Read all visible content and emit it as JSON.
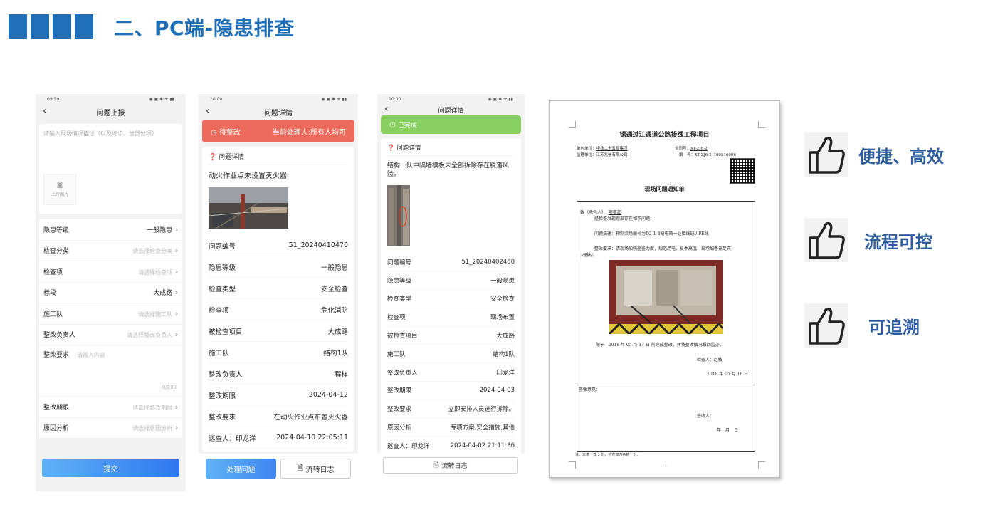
{
  "header": {
    "title": "二、PC端-隐患排查"
  },
  "phone1": {
    "status_time": "09:59",
    "nav_title": "问题上报",
    "desc_placeholder": "请输入现场情况描述（以及地点、分部分项）",
    "upload_label": "上传图片",
    "fields": [
      {
        "label": "隐患等级",
        "value": "一般隐患",
        "placeholder": false
      },
      {
        "label": "检查分类",
        "value": "请选择检查分类",
        "placeholder": true
      },
      {
        "label": "检查项",
        "value": "请选择检查项",
        "placeholder": true
      },
      {
        "label": "标段",
        "value": "大成路",
        "placeholder": false
      },
      {
        "label": "施工队",
        "value": "请选择施工队",
        "placeholder": true
      },
      {
        "label": "整改负责人",
        "value": "请选择整改负责人",
        "placeholder": true
      }
    ],
    "requirement_label": "整改要求",
    "requirement_placeholder": "请输入内容",
    "char_count": "0/200",
    "fields2": [
      {
        "label": "整改期限",
        "value": "请选择整改期限",
        "placeholder": true
      },
      {
        "label": "原因分析",
        "value": "请选择原因分析",
        "placeholder": true
      }
    ],
    "submit_label": "提交"
  },
  "phone2": {
    "status_time": "10:00",
    "nav_title": "问题详情",
    "status_label": "待整改",
    "handler_label": "当前处理人:所有人均可",
    "section_title": "问题详情",
    "description": "动火作业点未设置灭火器",
    "rows": [
      {
        "label": "问题编号",
        "value": "51_20240410470"
      },
      {
        "label": "隐患等级",
        "value": "一般隐患"
      },
      {
        "label": "检查类型",
        "value": "安全检查"
      },
      {
        "label": "检查项",
        "value": "危化消防"
      },
      {
        "label": "被检查项目",
        "value": "大成路"
      },
      {
        "label": "施工队",
        "value": "结构1队"
      },
      {
        "label": "整改负责人",
        "value": "程样"
      },
      {
        "label": "整改期限",
        "value": "2024-04-12"
      },
      {
        "label": "整改要求",
        "value": "在动火作业点布置灭火器"
      },
      {
        "label": "巡查人：印龙洋",
        "value": "2024-04-10 22:05:11"
      }
    ],
    "process_button": "处理问题",
    "log_button": "流转日志"
  },
  "phone3": {
    "status_time": "10:00",
    "nav_title": "问题详情",
    "status_label": "已完成",
    "section_title": "问题详情",
    "description": "结构一队中隔墙模板未全部拆除存在脱落风险。",
    "rows": [
      {
        "label": "问题编号",
        "value": "51_20240402460"
      },
      {
        "label": "隐患等级",
        "value": "一般隐患"
      },
      {
        "label": "检查类型",
        "value": "安全检查"
      },
      {
        "label": "检查项",
        "value": "现场布置"
      },
      {
        "label": "被检查项目",
        "value": "大成路"
      },
      {
        "label": "施工队",
        "value": "结构1队"
      },
      {
        "label": "整改负责人",
        "value": "印龙洋"
      },
      {
        "label": "整改期限",
        "value": "2024-04-03"
      },
      {
        "label": "整改要求",
        "value": "立即安排人员进行拆除。"
      },
      {
        "label": "原因分析",
        "value": "专项方案,安全措施,其他"
      },
      {
        "label": "巡查人：印龙洋",
        "value": "2024-04-02 21:11:36"
      }
    ],
    "log_button": "流转日志"
  },
  "document": {
    "title": "锡通过江通道公路接线工程项目",
    "contractor_label": "承包单位：",
    "contractor": "中铁二十五局集团",
    "contract_no_label": "合同号：",
    "contract_no": "XT-ZJ6-2",
    "supervisor_label": "监理单位：",
    "supervisor": "江苏兆信有限公司",
    "serial_label": "编　号：",
    "serial": "XT-ZJ6-2_180516006",
    "subtitle": "现场问题通知单",
    "to_line": "致（承包人）",
    "to_name": "项目部",
    "intro": "经检查发现你部存在如下问题：",
    "problem": "问题描述：预制梁场编号为D2-1-3配电箱一处接线缺少PE线",
    "requirement": "整改要求：请现场加强巡查力度，规范用电，夏季高温，现场配备充足灭",
    "requirement2": "火器材。",
    "deadline_prefix": "限于",
    "deadline": "2018 年 05 月 17 日 前完成整改，并将整改情况报回监办。",
    "inspector": "检查人：赵敏",
    "date": "2018 年 05 月 16 日",
    "sign_opinion": "签收意见：",
    "signer": "签收人：",
    "sign_date": "年　月　日",
    "footnote": "注：本表一式 2 份，检查双方各执一份。",
    "page": "1"
  },
  "benefits": [
    {
      "label": "便捷、高效",
      "icon": "thumbs-up-icon"
    },
    {
      "label": "流程可控",
      "icon": "thumbs-up-icon"
    },
    {
      "label": "可追溯",
      "icon": "thumbs-up-icon"
    }
  ],
  "colors": {
    "brand": "#1f6fb8",
    "pending": "#ec6a5c",
    "done": "#87cf5e",
    "button": "#3f86f0",
    "benefit_text": "#2e5d9e"
  }
}
